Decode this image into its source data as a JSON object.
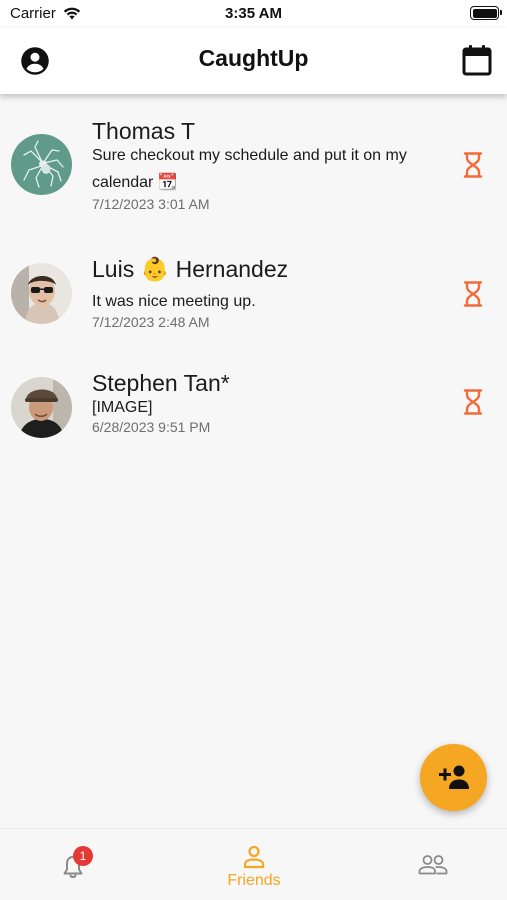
{
  "status_bar": {
    "carrier": "Carrier",
    "time": "3:35 AM"
  },
  "app_bar": {
    "title": "CaughtUp"
  },
  "friends": [
    {
      "name": "Thomas T",
      "message": "Sure checkout my schedule and put it on my calendar 📆",
      "timestamp": "7/12/2023 3:01 AM"
    },
    {
      "name": "Luis 👶 Hernandez",
      "message": "It was nice meeting up.",
      "timestamp": "7/12/2023 2:48 AM"
    },
    {
      "name": "Stephen Tan*",
      "message": "[IMAGE]",
      "timestamp": "6/28/2023 9:51 PM"
    }
  ],
  "bottom_nav": {
    "notifications_badge": "1",
    "friends_label": "Friends"
  },
  "colors": {
    "accent": "#f5a623",
    "hourglass": "#f26b3a",
    "badge": "#e53935"
  },
  "icons": [
    "wifi-icon",
    "battery-icon",
    "account-circle-icon",
    "calendar-icon",
    "hourglass-icon",
    "add-friend-icon",
    "bell-icon",
    "person-icon",
    "group-icon"
  ]
}
